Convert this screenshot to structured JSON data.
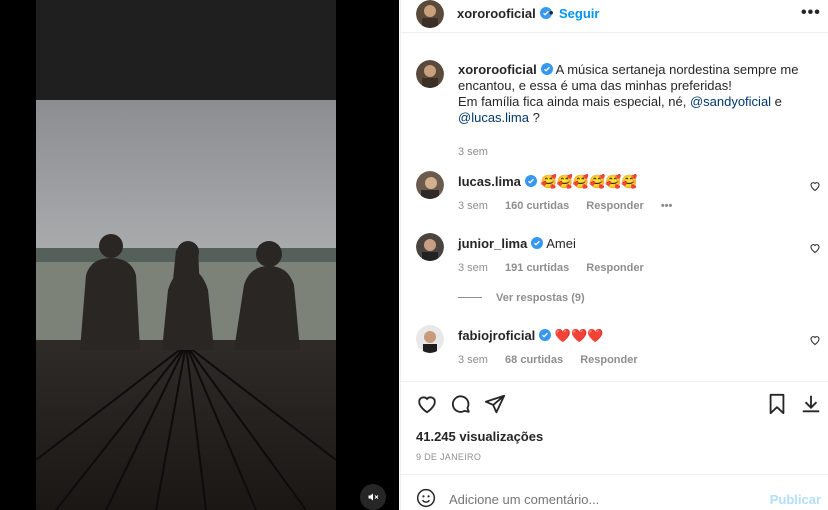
{
  "post": {
    "author": "xororooficial",
    "follow_label": "Seguir",
    "separator": "•",
    "more_label": "•••",
    "caption_part1": "A música sertaneja nordestina sempre me encantou, e essa é uma das minhas preferidas!",
    "caption_part2": "Em família fica ainda mais especial, né, ",
    "mention1": "@sandyoficial",
    "caption_and": " e ",
    "mention2": "@lucas.lima",
    "caption_end": " ?",
    "caption_time": "3 sem",
    "views": "41.245 visualizações",
    "date": "9 DE JANEIRO"
  },
  "comments": [
    {
      "user": "lucas.lima",
      "verified": true,
      "text": "🥰🥰🥰🥰🥰🥰",
      "time": "3 sem",
      "likes": "160 curtidas",
      "reply": "Responder",
      "options": "•••"
    },
    {
      "user": "junior_lima",
      "verified": true,
      "text": "Amei",
      "time": "3 sem",
      "likes": "191 curtidas",
      "reply": "Responder"
    },
    {
      "user": "fabiojroficial",
      "verified": true,
      "text": "❤️❤️❤️",
      "time": "3 sem",
      "likes": "68 curtidas",
      "reply": "Responder"
    }
  ],
  "view_replies": "Ver respostas (9)",
  "add_comment": {
    "placeholder": "Adicione um comentário...",
    "post_label": "Publicar"
  },
  "colors": {
    "accent": "#0095f6",
    "verified": "#3897f0",
    "muted": "#8e8e8e"
  },
  "icons": [
    "volume-off-icon",
    "heart-icon",
    "comment-icon",
    "share-icon",
    "bookmark-icon",
    "download-icon",
    "emoji-icon",
    "verified-icon"
  ]
}
